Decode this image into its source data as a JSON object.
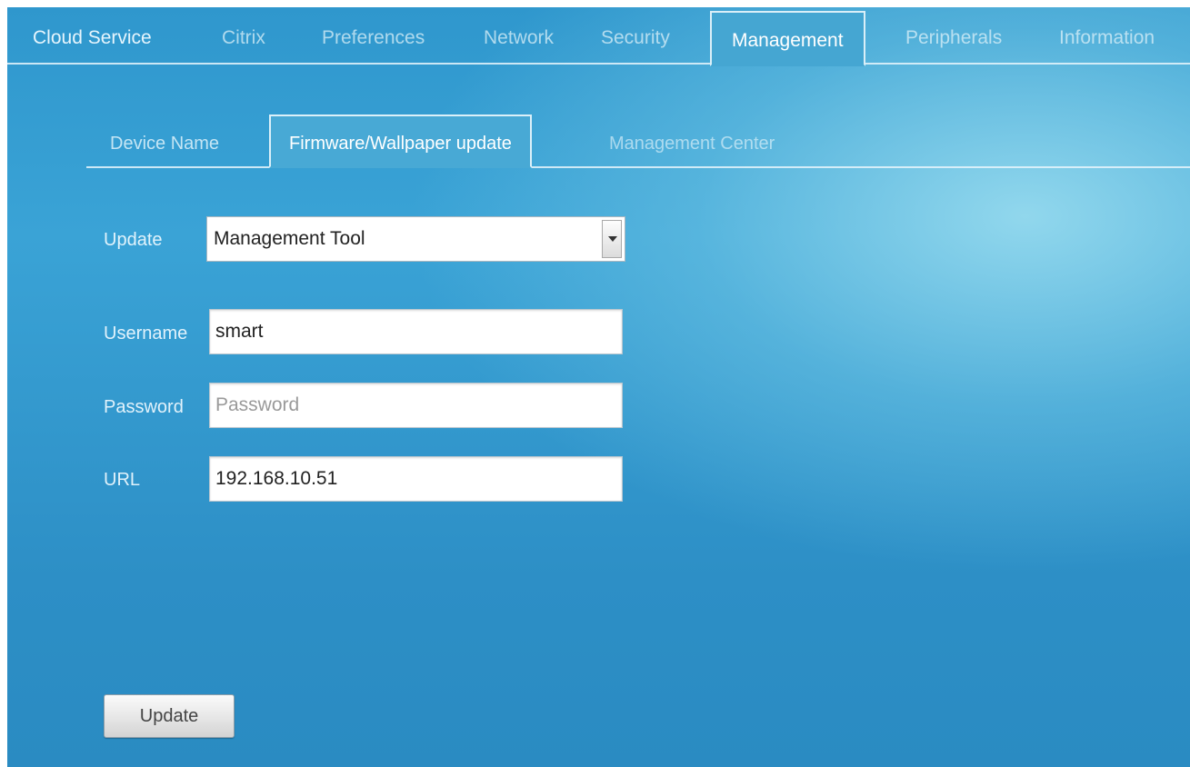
{
  "top_tabs": [
    {
      "label": "Cloud Service",
      "active": false
    },
    {
      "label": "Citrix",
      "active": false
    },
    {
      "label": "Preferences",
      "active": false
    },
    {
      "label": "Network",
      "active": false
    },
    {
      "label": "Security",
      "active": false
    },
    {
      "label": "Management",
      "active": true
    },
    {
      "label": "Peripherals",
      "active": false
    },
    {
      "label": "Information",
      "active": false
    }
  ],
  "sub_tabs": [
    {
      "label": "Device Name",
      "active": false
    },
    {
      "label": "Firmware/Wallpaper update",
      "active": true
    },
    {
      "label": "Management Center",
      "active": false
    }
  ],
  "form": {
    "update": {
      "label": "Update",
      "selected": "Management Tool"
    },
    "username": {
      "label": "Username",
      "value": "smart"
    },
    "password": {
      "label": "Password",
      "value": "",
      "placeholder": "Password"
    },
    "url": {
      "label": "URL",
      "value": "192.168.10.51"
    }
  },
  "actions": {
    "update_label": "Update"
  },
  "colors": {
    "panel_blue": "#2f97cd",
    "tab_active": "#45a6d2",
    "highlight": "#96daee"
  }
}
